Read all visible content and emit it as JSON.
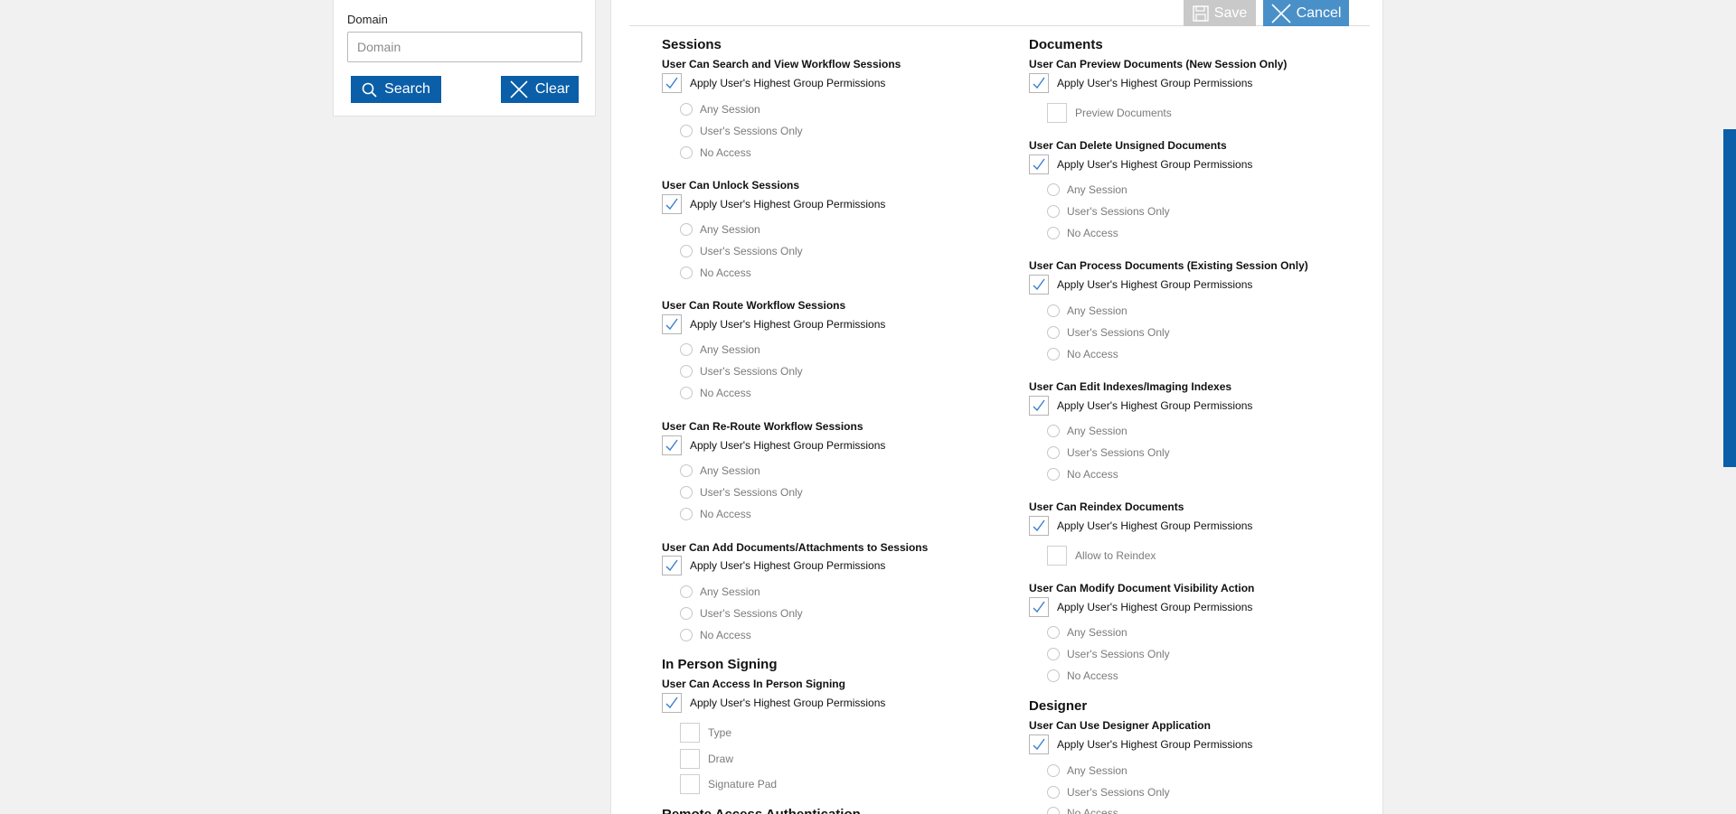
{
  "search_panel": {
    "domain_label": "Domain",
    "domain_placeholder": "Domain",
    "search_label": "Search",
    "clear_label": "Clear"
  },
  "toolbar": {
    "save_label": "Save",
    "cancel_label": "Cancel"
  },
  "options": {
    "apply_label": "Apply User's Highest Group Permissions",
    "any_session": "Any Session",
    "users_sessions_only": "User's Sessions Only",
    "no_access": "No Access"
  },
  "left": {
    "sessions_title": "Sessions",
    "search_view": "User Can Search and View Workflow Sessions",
    "unlock": "User Can Unlock Sessions",
    "route": "User Can Route Workflow Sessions",
    "reroute": "User Can Re-Route Workflow Sessions",
    "add_docs": "User Can Add Documents/Attachments to Sessions",
    "in_person_title": "In Person Signing",
    "in_person_access": "User Can Access In Person Signing",
    "type": "Type",
    "draw": "Draw",
    "signature_pad": "Signature Pad",
    "remote_access_title": "Remote Access Authentication"
  },
  "right": {
    "documents_title": "Documents",
    "preview": "User Can Preview Documents (New Session Only)",
    "preview_documents": "Preview Documents",
    "delete_unsigned": "User Can Delete Unsigned Documents",
    "process": "User Can Process Documents (Existing Session Only)",
    "edit_indexes": "User Can Edit Indexes/Imaging Indexes",
    "reindex": "User Can Reindex Documents",
    "allow_reindex": "Allow to Reindex",
    "visibility": "User Can Modify Document Visibility Action",
    "designer_title": "Designer",
    "designer_use": "User Can Use Designer Application"
  },
  "colors": {
    "accent": "#0b5ea8",
    "save_disabled": "#c9c9c9",
    "cancel": "#4a90c8"
  }
}
